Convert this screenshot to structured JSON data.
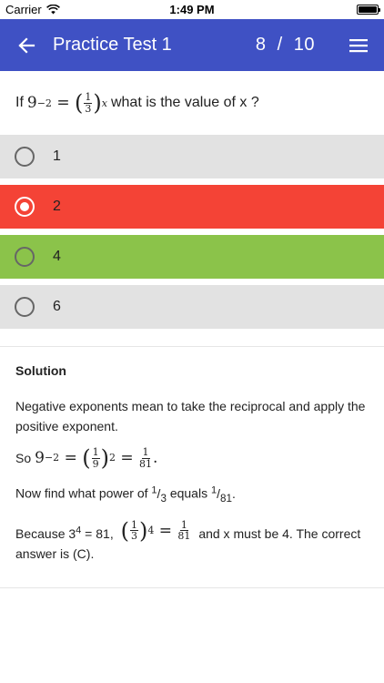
{
  "status": {
    "carrier": "Carrier",
    "time": "1:49 PM"
  },
  "appbar": {
    "title": "Practice Test 1",
    "counter": "8  /  10"
  },
  "question": {
    "prefix": "If",
    "suffix": "what is the value of x ?"
  },
  "options": [
    {
      "label": "1",
      "selected": false,
      "state": "neutral",
      "color": "#e2e2e2"
    },
    {
      "label": "2",
      "selected": true,
      "state": "incorrect",
      "color": "#f44336"
    },
    {
      "label": "4",
      "selected": false,
      "state": "correct",
      "color": "#8bc34a"
    },
    {
      "label": "6",
      "selected": false,
      "state": "neutral",
      "color": "#e2e2e2"
    }
  ],
  "solution": {
    "heading": "Solution",
    "p1": "Negative exponents mean to take the reciprocal and apply the positive exponent.",
    "p2_prefix": "So",
    "p3_prefix": "Now find what power of",
    "p3_mid": "equals",
    "p4_prefix": "Because 3",
    "p4_exp": "4",
    "p4_eq": " = 81,",
    "p4_suffix": "and x must be 4. The correct answer is (C)."
  },
  "colors": {
    "appbar": "#3f51c4",
    "incorrect": "#f44336",
    "correct": "#8bc34a",
    "neutral": "#e2e2e2"
  }
}
